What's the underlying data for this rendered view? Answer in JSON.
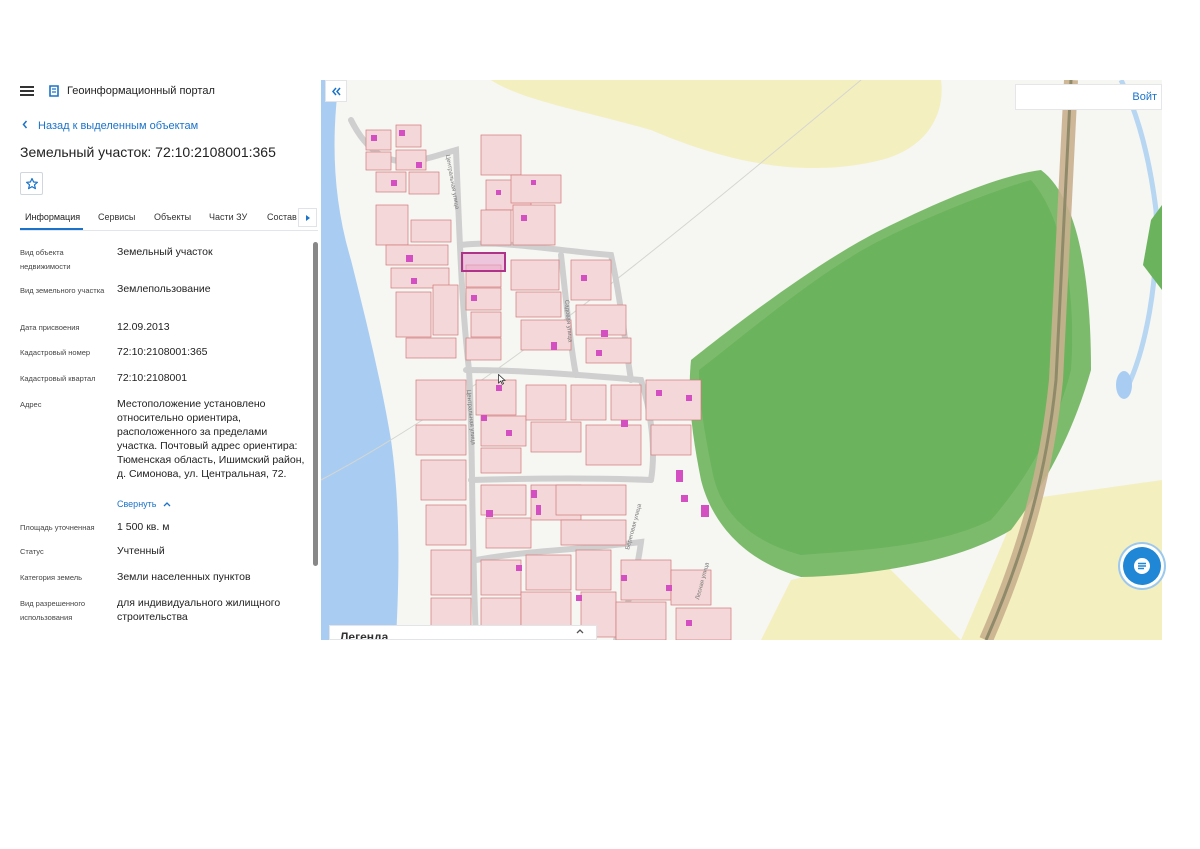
{
  "header": {
    "app_title": "Геоинформационный портал"
  },
  "nav": {
    "back_label": "Назад к выделенным объектам"
  },
  "object": {
    "title": "Земельный участок: 72:10:2108001:365"
  },
  "tabs": [
    {
      "label": "Информация"
    },
    {
      "label": "Сервисы"
    },
    {
      "label": "Объекты"
    },
    {
      "label": "Части ЗУ"
    },
    {
      "label": "Состав"
    }
  ],
  "properties": [
    {
      "label": "Вид объекта недвижимости",
      "value": "Земельный участок"
    },
    {
      "label": "Вид земельного участка",
      "value": "Землепользование"
    },
    {
      "label": "Дата присвоения",
      "value": "12.09.2013"
    },
    {
      "label": "Кадастровый номер",
      "value": "72:10:2108001:365"
    },
    {
      "label": "Кадастровый квартал",
      "value": "72:10:2108001"
    },
    {
      "label": "Адрес",
      "value": "Местоположение установлено относительно ориентира, расположенного за пределами участка. Почтовый адрес ориентира: Тюменская область, Ишимский район, д. Симонова, ул. Центральная, 72."
    },
    {
      "label": "Площадь уточненная",
      "value": "1 500 кв. м"
    },
    {
      "label": "Статус",
      "value": "Учтенный"
    },
    {
      "label": "Категория земель",
      "value": "Земли населенных пунктов"
    },
    {
      "label": "Вид разрешенного использования",
      "value": "для индивидуального жилищного строительства"
    }
  ],
  "address_toggle": "Свернуть",
  "map": {
    "login_label": "Войт",
    "legend_title": "Легенда",
    "street_labels": [
      "Центральная улица",
      "Центральная улица",
      "Садовая улица",
      "Береговая улица",
      "Лесная улица"
    ]
  },
  "colors": {
    "accent": "#1a73c9",
    "parcel_fill": "#f4d7d8",
    "parcel_stroke": "#d07a7a",
    "selected_parcel": "#b0338a",
    "forest": "#6cb35e",
    "river": "#a9cdf2",
    "field": "#f3efbf"
  }
}
